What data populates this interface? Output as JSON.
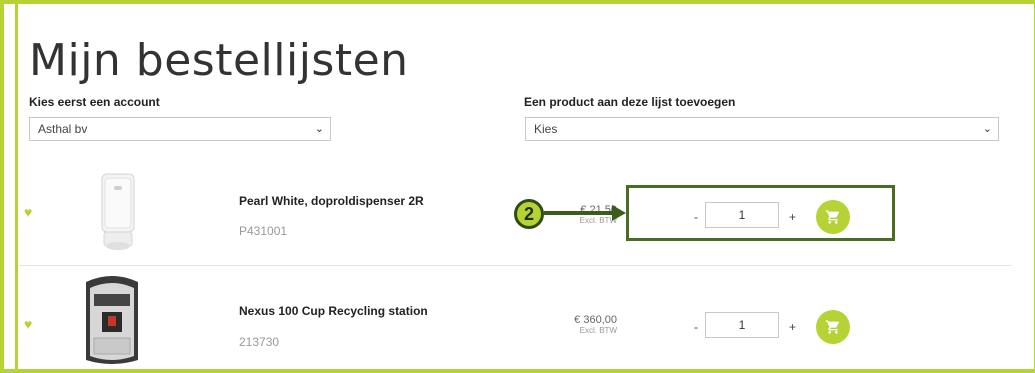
{
  "page": {
    "title": "Mijn bestellijsten"
  },
  "account": {
    "label": "Kies eerst een account",
    "selected": "Asthal bv"
  },
  "add_product": {
    "label": "Een product aan deze lijst toevoegen",
    "selected": "Kies"
  },
  "products": [
    {
      "name": "Pearl White, doproldispenser 2R",
      "code": "P431001",
      "price": "€ 21,50",
      "tax_note": "Excl. BTW",
      "minus": "-",
      "plus": "+",
      "quantity": "1",
      "image_icon": "toilet-roll-dispenser-image"
    },
    {
      "name": "Nexus 100 Cup Recycling station",
      "code": "213730",
      "price": "€ 360,00",
      "tax_note": "Excl. BTW",
      "minus": "-",
      "plus": "+",
      "quantity": "1",
      "image_icon": "recycling-station-image"
    }
  ],
  "annotation": {
    "step": "2"
  },
  "colors": {
    "accent": "#b5d334",
    "annotation": "#3b5c1a"
  }
}
